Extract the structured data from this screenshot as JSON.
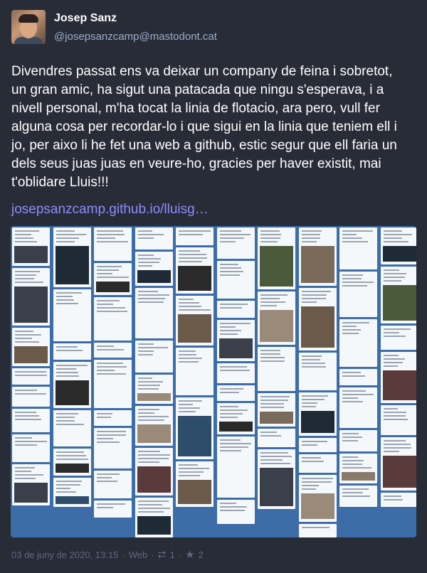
{
  "author": {
    "display_name": "Josep Sanz",
    "account": "@josepsanzcamp@mastodont.cat",
    "avatar_icon": "user-avatar-icon"
  },
  "status": {
    "text": "Divendres passat ens va deixar un company de feina i sobretot, un gran amic, ha sigut una patacada que ningu s'esperava, i a nivell personal, m'ha tocat la linia de flotacio, ara pero, vull fer alguna cosa per recordar-lo i que sigui en la linia que teniem ell i jo, per aixo li he fet una web a github, estic segur que ell faria un dels seus juas juas en veure-ho, gracies per haver existit, mai t'oblidare Lluis!!!",
    "link": "josepsanzcamp.github.io/lluisg…"
  },
  "media": {
    "background_color": "#3c6da8",
    "description_icon": "tweet-collage-image"
  },
  "meta": {
    "date": "03 de juny de 2020, 13:15",
    "separator": "·",
    "application": "Web",
    "boost_icon": "retweet-icon",
    "boost_count": "1",
    "favourite_icon": "star-icon",
    "favourite_count": "2"
  },
  "colors": {
    "background": "#282c37",
    "text": "#ffffff",
    "secondary": "#9baec8",
    "link": "#8c8dff",
    "muted": "#606984"
  }
}
